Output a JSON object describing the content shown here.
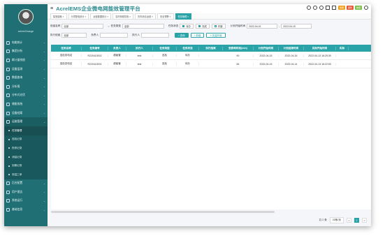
{
  "header": {
    "title": "AcrelEMS企业微电网能效管理平台",
    "badges": [
      {
        "text": "告警",
        "color": "#f0a020"
      },
      {
        "text": "事件",
        "color": "#e65a3c"
      },
      {
        "text": "故障",
        "color": "#7cc04b"
      }
    ]
  },
  "user": {
    "name": "adminChange"
  },
  "sidebar": {
    "items": [
      {
        "label": "电能统计",
        "icon": "chart-icon"
      },
      {
        "label": "集团分析",
        "icon": "building-icon"
      },
      {
        "label": "碳计量排放",
        "icon": "leaf-icon"
      },
      {
        "label": "设备监测",
        "icon": "monitor-icon"
      },
      {
        "label": "数据查询",
        "icon": "search-icon"
      },
      {
        "label": "分析报",
        "icon": "report-icon"
      },
      {
        "label": "分布式光伏",
        "icon": "solar-icon"
      },
      {
        "label": "储能系统",
        "icon": "battery-icon"
      },
      {
        "label": "设备档案",
        "icon": "archive-icon"
      },
      {
        "label": "运维管理",
        "icon": "tool-icon"
      }
    ],
    "subitems": [
      "任务管理",
      "巡检记录",
      "抢修记录",
      "消缺记录",
      "到期记录",
      "测温工单"
    ],
    "bottom_items": [
      {
        "label": "后台配置",
        "icon": "gear-icon"
      },
      {
        "label": "用户报告",
        "icon": "user-icon"
      },
      {
        "label": "系统运行",
        "icon": "system-icon"
      },
      {
        "label": "基础信息",
        "icon": "info-icon"
      }
    ]
  },
  "tabs": [
    "智慧能耗",
    "分项配电统计",
    "运营数据统计",
    "实时网络供电",
    "历年综合运营",
    "安全预警",
    "任务管理"
  ],
  "filters": {
    "org_label": "班组名称",
    "org_value": "全部",
    "task_type_label": "任务类型",
    "task_type_value": "全部",
    "task_status_label": "任务状态",
    "status_opts": [
      {
        "label": "待办",
        "checked": true
      },
      {
        "label": "完成",
        "checked": true
      },
      {
        "label": "作废",
        "checked": false
      }
    ],
    "plan_time_label": "计划开始时间",
    "date_from": "2022-04-01",
    "date_sep": "-",
    "date_to": "2022-04-15",
    "person_label": "执行班组",
    "person_value": "全部",
    "leader_label": "负责人",
    "executor_label": "执行人",
    "buttons": {
      "query": "查询",
      "add": "新增",
      "batch": "批量作废"
    }
  },
  "table": {
    "columns": [
      "任务名称",
      "任务编号",
      "负责人",
      "执行人",
      "任务类型",
      "任务状态",
      "执行结果",
      "受影响时段(min)",
      "计划开始时间",
      "计划结束时间",
      "实际开始时间",
      "实际"
    ],
    "rows": [
      [
        "巡检变电站",
        "R220410002",
        "超级管",
        "test",
        "巡检",
        "待办",
        "",
        "90",
        "2022-04-15",
        "2022-04-16",
        "2022-04-13 16:25:39",
        ""
      ],
      [
        "巡检变电站",
        "R220410001",
        "超级管",
        "test",
        "巡检",
        "待办",
        "",
        "84",
        "2022-04-15",
        "2022-04-14",
        "2022-04-13 16:22:53",
        ""
      ]
    ]
  },
  "footer": {
    "total": "共 2 条",
    "page_size": "20条/页",
    "current_page": "1",
    "prev": "<",
    "next": ">"
  }
}
